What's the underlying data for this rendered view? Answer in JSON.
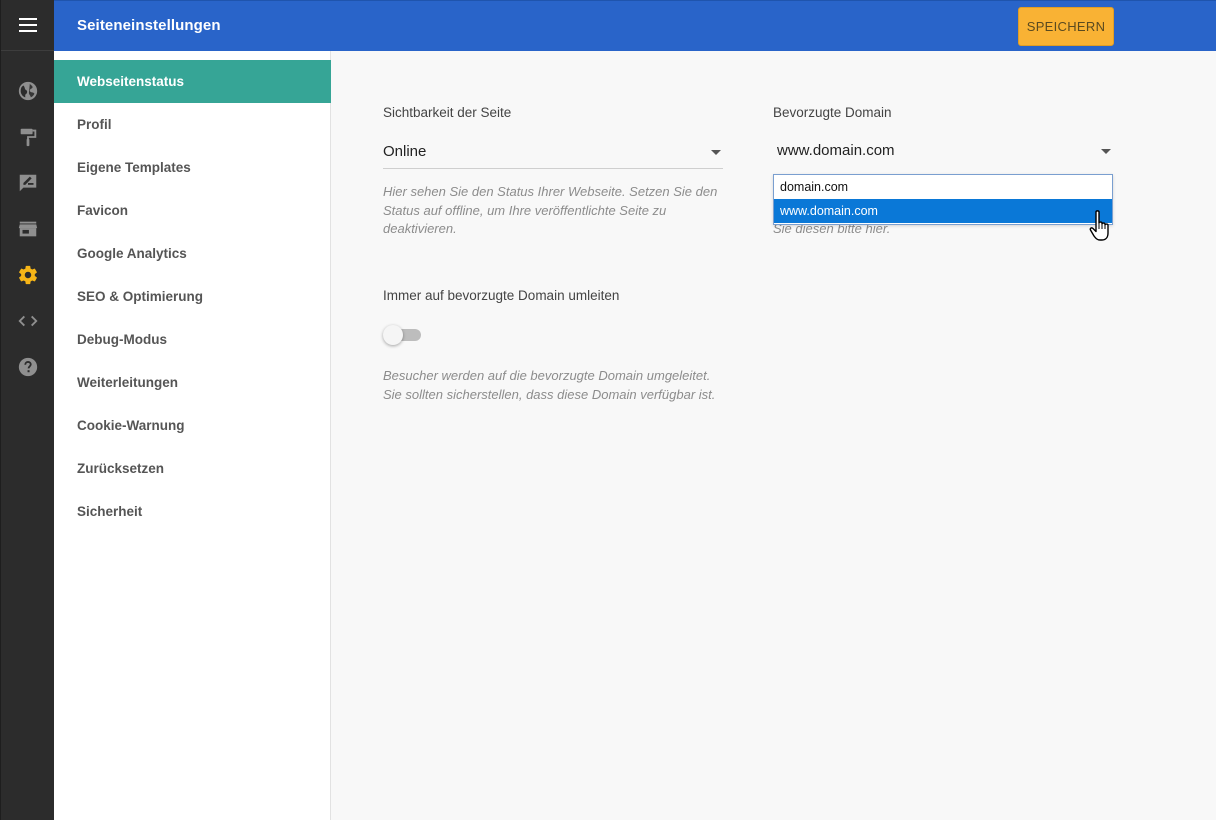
{
  "header": {
    "title": "Seiteneinstellungen",
    "save_label": "SPEICHERN"
  },
  "rail": {
    "icons": [
      "menu-icon",
      "globe-icon",
      "paint-roller-icon",
      "edit-note-icon",
      "store-icon",
      "gear-icon",
      "code-icon",
      "help-icon"
    ],
    "active_icon": "gear-icon",
    "active_color": "#f6b517"
  },
  "sidebar": {
    "items": [
      {
        "label": "Webseitenstatus"
      },
      {
        "label": "Profil"
      },
      {
        "label": "Eigene Templates"
      },
      {
        "label": "Favicon"
      },
      {
        "label": "Google Analytics"
      },
      {
        "label": "SEO & Optimierung"
      },
      {
        "label": "Debug-Modus"
      },
      {
        "label": "Weiterleitungen"
      },
      {
        "label": "Cookie-Warnung"
      },
      {
        "label": "Zurücksetzen"
      },
      {
        "label": "Sicherheit"
      }
    ],
    "active_index": 0
  },
  "main": {
    "visibility": {
      "label": "Sichtbarkeit der Seite",
      "value": "Online",
      "help": "Hier sehen Sie den Status Ihrer Webseite. Setzen Sie den Status auf offline, um Ihre veröffentlichte Seite zu deaktivieren."
    },
    "domain": {
      "label": "Bevorzugte Domain",
      "value": "www.domain.com",
      "help_visible": "Sie diesen bitte hier.",
      "options": [
        "domain.com",
        "www.domain.com"
      ],
      "selected_option": "www.domain.com"
    },
    "redirect": {
      "label": "Immer auf bevorzugte Domain umleiten",
      "enabled": false,
      "help": "Besucher werden auf die bevorzugte Domain umgeleitet. Sie sollten sicherstellen, dass diese Domain verfügbar ist."
    }
  },
  "colors": {
    "header_bg": "#2964c9",
    "save_button": "#f9b234",
    "active_sidebar": "#36a596",
    "rail_bg": "#2c2c2c",
    "dropdown_selected": "#0a78d7"
  }
}
